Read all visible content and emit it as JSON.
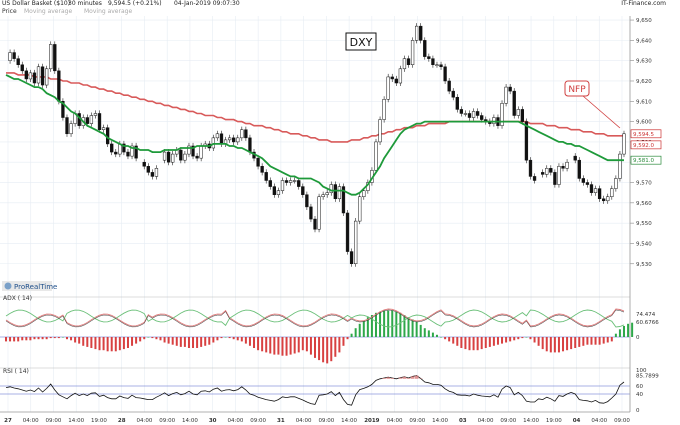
{
  "header": {
    "instrument": "US Dollar Basket ($10)",
    "interval": "30 minutes",
    "last": "9,594.5 (+0.21%)",
    "date": "04-Jan-2019 09:07:30",
    "source": "IT-Finance.com",
    "legend": "Price",
    "legend_ma1": "Moving average",
    "legend_ma2": "Moving average"
  },
  "annotations": {
    "symbol_label": "DXY",
    "event_label": "NFP"
  },
  "panels": {
    "watermark": "ProRealTime",
    "adx_label": "ADX ( 14)",
    "rsi_label": "RSI ( 14)"
  },
  "chart_data": [
    {
      "type": "candlestick",
      "title": "",
      "ylim": [
        9522,
        9652
      ],
      "y_ticks": [
        9530,
        9540,
        9550,
        9560,
        9570,
        9580,
        9590,
        9600,
        9610,
        9620,
        9630,
        9640,
        9650
      ],
      "y_tick_labels": [
        "9,530",
        "9,540",
        "9,550",
        "9,560",
        "9,570",
        "9,580",
        "9,590",
        "9,600",
        "9,610",
        "9,620",
        "9,630",
        "9,640",
        "9,650"
      ],
      "price_tags": [
        "9,594.5",
        "9,592.0",
        "9,581.0"
      ],
      "tag_colors": [
        "#cc3333",
        "#cc3333",
        "#2a8a3a"
      ],
      "x_tick_labels": [
        "27",
        "04:00",
        "09:00",
        "14:00",
        "19:00",
        "28",
        "04:00",
        "09:00",
        "14:00",
        "30",
        "04:00",
        "09:00",
        "31",
        "04:00",
        "09:00",
        "14:00",
        "2019",
        "04:00",
        "09:00",
        "14:00",
        "03",
        "04:00",
        "09:00",
        "14:00",
        "19:00",
        "04",
        "04:00",
        "09:00"
      ],
      "bold_ticks": [
        "27",
        "28",
        "30",
        "31",
        "2019",
        "03",
        "04"
      ],
      "close": [
        9630,
        9634,
        9631,
        9628,
        9625,
        9621,
        9624,
        9619,
        9627,
        9618,
        9626,
        9638,
        9625,
        9610,
        9602,
        9594,
        9599,
        9604,
        9598,
        9602,
        9599,
        9603,
        9604,
        9596,
        9597,
        9589,
        9585,
        9584,
        9589,
        9585,
        9583,
        9588,
        9582,
        9580,
        9578,
        9575,
        9573,
        9577,
        9581,
        9585,
        9580,
        9584,
        9586,
        9581,
        9584,
        9588,
        9583,
        9582,
        9588,
        9589,
        9587,
        9592,
        9594,
        9589,
        9591,
        9592,
        9590,
        9592,
        9596,
        9592,
        9585,
        9582,
        9578,
        9575,
        9571,
        9568,
        9564,
        9566,
        9571,
        9570,
        9571,
        9571,
        9568,
        9564,
        9558,
        9552,
        9547,
        9563,
        9564,
        9565,
        9569,
        9562,
        9568,
        9555,
        9536,
        9530,
        9551,
        9563,
        9566,
        9570,
        9576,
        9590,
        9601,
        9611,
        9622,
        9621,
        9619,
        9626,
        9631,
        9628,
        9640,
        9647,
        9640,
        9632,
        9631,
        9628,
        9628,
        9627,
        9620,
        9615,
        9612,
        9606,
        9604,
        9604,
        9602,
        9605,
        9603,
        9601,
        9600,
        9599,
        9602,
        9598,
        9609,
        9617,
        9615,
        9603,
        9606,
        9600,
        9581,
        9573,
        9571,
        9575,
        9574,
        9577,
        9575,
        9569,
        9578,
        9577,
        9580,
        9583,
        9581,
        9572,
        9570,
        9569,
        9565,
        9567,
        9562,
        9561,
        9563,
        9567,
        9572,
        9584,
        9594
      ],
      "gaps": [
        33,
        38,
        131,
        139
      ],
      "ma_green": [
        9623,
        9622,
        9621,
        9621,
        9620,
        9619,
        9618,
        9617,
        9617,
        9616,
        9614,
        9613,
        9612,
        9610,
        9609,
        9607,
        9605,
        9604,
        9602,
        9600,
        9598,
        9597,
        9596,
        9595,
        9594,
        9592,
        9591,
        9590,
        9589,
        9588,
        9588,
        9587,
        9587,
        9586,
        9586,
        9586,
        9585,
        9585,
        9585,
        9586,
        9586,
        9586,
        9586,
        9587,
        9587,
        9587,
        9587,
        9588,
        9588,
        9588,
        9588,
        9589,
        9589,
        9589,
        9589,
        9588,
        9588,
        9587,
        9587,
        9586,
        9585,
        9584,
        9583,
        9582,
        9580,
        9578,
        9577,
        9576,
        9575,
        9574,
        9573,
        9573,
        9572,
        9572,
        9572,
        9572,
        9571,
        9570,
        9568,
        9567,
        9566,
        9566,
        9566,
        9566,
        9565,
        9564,
        9564,
        9565,
        9567,
        9569,
        9572,
        9575,
        9578,
        9582,
        9585,
        9588,
        9591,
        9594,
        9596,
        9597,
        9598,
        9599,
        9599,
        9600,
        9600,
        9600,
        9600,
        9600,
        9600,
        9600,
        9600,
        9600,
        9600,
        9600,
        9600,
        9600,
        9600,
        9600,
        9600,
        9600,
        9600,
        9600,
        9600,
        9600,
        9600,
        9600,
        9600,
        9599,
        9598,
        9597,
        9596,
        9595,
        9594,
        9593,
        9592,
        9591,
        9590,
        9590,
        9589,
        9589,
        9588,
        9588,
        9587,
        9586,
        9585,
        9584,
        9583,
        9582,
        9581,
        9581,
        9581,
        9581,
        9581
      ],
      "ma_red": [
        9624,
        9624,
        9624,
        9623,
        9623,
        9623,
        9623,
        9622,
        9622,
        9622,
        9622,
        9621,
        9621,
        9621,
        9620,
        9620,
        9619,
        9619,
        9619,
        9618,
        9618,
        9617,
        9617,
        9616,
        9616,
        9615,
        9615,
        9614,
        9614,
        9613,
        9613,
        9612,
        9612,
        9611,
        9611,
        9610,
        9610,
        9609,
        9609,
        9608,
        9608,
        9607,
        9607,
        9606,
        9606,
        9605,
        9605,
        9604,
        9604,
        9603,
        9603,
        9603,
        9602,
        9602,
        9601,
        9601,
        9601,
        9600,
        9600,
        9599,
        9599,
        9598,
        9598,
        9598,
        9597,
        9597,
        9596,
        9596,
        9595,
        9595,
        9594,
        9594,
        9594,
        9593,
        9593,
        9592,
        9592,
        9591,
        9591,
        9591,
        9590,
        9590,
        9590,
        9590,
        9590,
        9591,
        9591,
        9591,
        9592,
        9592,
        9593,
        9593,
        9594,
        9594,
        9595,
        9595,
        9596,
        9596,
        9597,
        9597,
        9597,
        9598,
        9598,
        9598,
        9599,
        9599,
        9599,
        9599,
        9599,
        9600,
        9600,
        9600,
        9600,
        9600,
        9600,
        9600,
        9600,
        9600,
        9600,
        9600,
        9600,
        9600,
        9600,
        9600,
        9600,
        9600,
        9600,
        9600,
        9600,
        9599,
        9599,
        9599,
        9599,
        9598,
        9598,
        9598,
        9597,
        9597,
        9597,
        9596,
        9596,
        9596,
        9595,
        9595,
        9595,
        9594,
        9594,
        9594,
        9593,
        9593,
        9593,
        9593,
        9593
      ]
    },
    {
      "type": "bar",
      "title": "ADX ( 14)",
      "y_tick_labels": [
        "74.474",
        "60.6766",
        "0"
      ],
      "values": [
        -4,
        -4,
        -4,
        -4,
        -3,
        -3,
        -3,
        -2,
        -2,
        -2,
        -2,
        -1,
        -1,
        -1,
        0,
        -2,
        -3,
        -5,
        -6,
        -8,
        -9,
        -10,
        -11,
        -12,
        -12,
        -13,
        -13,
        -13,
        -12,
        -11,
        -10,
        -8,
        -6,
        -4,
        -2,
        0,
        -1,
        -2,
        -3,
        -5,
        -6,
        -7,
        -8,
        -9,
        -9,
        -10,
        -10,
        -10,
        -9,
        -8,
        -7,
        -5,
        -3,
        -1,
        0,
        -1,
        -2,
        -3,
        -4,
        -6,
        -8,
        -10,
        -12,
        -13,
        -14,
        -15,
        -16,
        -16,
        -17,
        -17,
        -16,
        -15,
        -14,
        -12,
        -13,
        -16,
        -19,
        -21,
        -23,
        -24,
        -22,
        -18,
        -14,
        -8,
        -2,
        3,
        8,
        12,
        15,
        18,
        20,
        22,
        23,
        24,
        24,
        24,
        23,
        22,
        20,
        18,
        16,
        14,
        11,
        8,
        6,
        4,
        2,
        0,
        -2,
        -4,
        -6,
        -8,
        -10,
        -11,
        -12,
        -12,
        -12,
        -11,
        -10,
        -9,
        -8,
        -7,
        -6,
        -5,
        -4,
        -3,
        -2,
        -1,
        0,
        -2,
        -5,
        -8,
        -11,
        -13,
        -14,
        -14,
        -14,
        -13,
        -12,
        -11,
        -10,
        -9,
        -8,
        -7,
        -7,
        -7,
        -7,
        -6,
        -5,
        -4,
        3,
        7,
        10,
        12,
        13
      ]
    },
    {
      "type": "line",
      "title": "RSI ( 14)",
      "ylim": [
        0,
        100
      ],
      "y_tick_labels": [
        "100",
        "85.7899",
        "60",
        "40",
        "0"
      ],
      "values": [
        56,
        58,
        55,
        53,
        50,
        47,
        50,
        46,
        55,
        45,
        54,
        65,
        50,
        38,
        33,
        28,
        36,
        42,
        36,
        40,
        36,
        42,
        43,
        34,
        37,
        31,
        28,
        28,
        35,
        31,
        29,
        37,
        31,
        30,
        28,
        26,
        26,
        32,
        37,
        43,
        36,
        41,
        44,
        38,
        41,
        47,
        40,
        38,
        47,
        48,
        45,
        52,
        55,
        47,
        50,
        51,
        48,
        51,
        58,
        50,
        40,
        37,
        32,
        29,
        26,
        24,
        22,
        26,
        33,
        31,
        33,
        33,
        29,
        25,
        20,
        16,
        14,
        37,
        38,
        40,
        46,
        36,
        44,
        26,
        14,
        12,
        38,
        51,
        54,
        58,
        64,
        74,
        78,
        80,
        82,
        80,
        78,
        81,
        83,
        80,
        84,
        86,
        79,
        70,
        68,
        64,
        64,
        62,
        53,
        47,
        44,
        38,
        37,
        37,
        35,
        40,
        37,
        35,
        34,
        33,
        38,
        32,
        52,
        60,
        56,
        38,
        44,
        36,
        22,
        20,
        20,
        28,
        26,
        32,
        28,
        22,
        36,
        34,
        40,
        44,
        40,
        26,
        24,
        23,
        20,
        24,
        18,
        17,
        21,
        30,
        40,
        62,
        70
      ]
    }
  ]
}
